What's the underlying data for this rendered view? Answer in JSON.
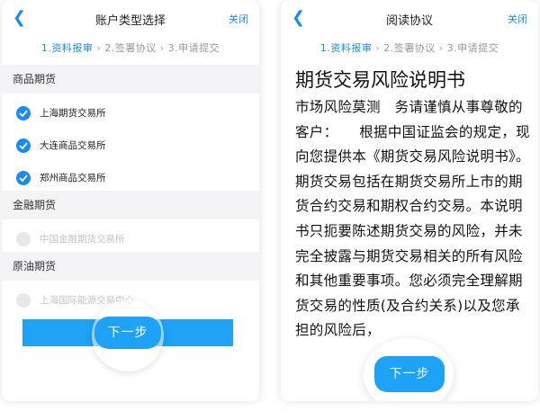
{
  "left": {
    "title": "账户类型选择",
    "close": "关闭",
    "steps": [
      "1.资料报审",
      "2.签署协议",
      "3.申请提交"
    ],
    "sections": [
      {
        "title": "商品期货",
        "options": [
          {
            "label": "上海期货交易所",
            "checked": true
          },
          {
            "label": "大连商品交易所",
            "checked": true
          },
          {
            "label": "郑州商品交易所",
            "checked": true
          }
        ]
      },
      {
        "title": "金融期货",
        "options": [
          {
            "label": "中国金融期货交易所",
            "checked": false
          }
        ]
      },
      {
        "title": "原油期货",
        "options": [
          {
            "label": "上海国际能源交易中心",
            "checked": false
          }
        ]
      }
    ],
    "next_label": "下一步"
  },
  "right": {
    "title": "阅读协议",
    "close": "关闭",
    "steps": [
      "1.资料报审",
      "2.签署协议",
      "3.申请提交"
    ],
    "doc_title": "期货交易风险说明书",
    "doc_text": "市场风险莫测　务请谨慎从事尊敬的客户：　　根据中国证监会的规定，现向您提供本《期货交易风险说明书》。期货交易包括在期货交易所上市的期货合约交易和期权合约交易。本说明书只扼要陈述期货交易的风险，并未完全披露与期货交易相关的所有风险和其他重要事项。您必须完全理解期货交易的性质(及合约关系)以及您承担的风险后，",
    "next_label": "下一步"
  },
  "colors": {
    "accent": "#1a8cf0",
    "button": "#1ea2f5",
    "section_bg": "#f4f4f6"
  }
}
